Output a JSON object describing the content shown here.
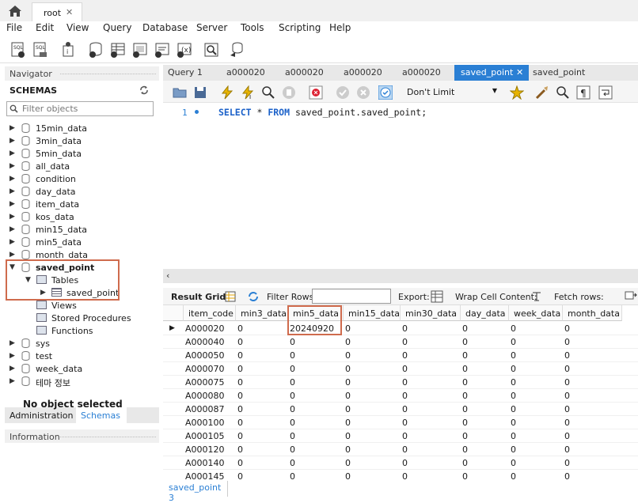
{
  "app": {
    "connection_tab": "root",
    "close_glyph": "✕"
  },
  "menu": [
    "File",
    "Edit",
    "View",
    "Query",
    "Database",
    "Server",
    "Tools",
    "Scripting",
    "Help"
  ],
  "navigator": {
    "header": "Navigator",
    "schemas_title": "SCHEMAS",
    "filter_placeholder": "Filter objects",
    "schemas": [
      "15min_data",
      "3min_data",
      "5min_data",
      "all_data",
      "condition",
      "day_data",
      "item_data",
      "kos_data",
      "min15_data",
      "min5_data",
      "month_data"
    ],
    "expanded_schema": {
      "name": "saved_point",
      "tables_label": "Tables",
      "table": "saved_point",
      "views": "Views",
      "procedures": "Stored Procedures",
      "functions": "Functions"
    },
    "schemas_after": [
      "sys",
      "test",
      "week_data",
      "테마 정보"
    ],
    "tab_administration": "Administration",
    "tab_schemas": "Schemas",
    "info_header": "Information",
    "no_object": "No object selected"
  },
  "query_tabs": [
    "Query 1",
    "a000020",
    "a000020",
    "a000020",
    "a000020",
    "saved_point",
    "saved_point"
  ],
  "editor": {
    "limit": "Don't Limit",
    "line_number": "1",
    "sql_kw1": "SELECT",
    "sql_mid": " * ",
    "sql_kw2": "FROM",
    "sql_rest": " saved_point.saved_point;"
  },
  "results": {
    "result_grid": "Result Grid",
    "filter_rows": "Filter Rows:",
    "export": "Export:",
    "wrap_cell": "Wrap Cell Content:",
    "fetch_rows": "Fetch rows:",
    "columns": [
      "item_code",
      "min3_data",
      "min5_data",
      "min15_data",
      "min30_data",
      "day_data",
      "week_data",
      "month_data"
    ],
    "rows": [
      [
        "A000020",
        "0",
        "20240920",
        "0",
        "0",
        "0",
        "0",
        "0"
      ],
      [
        "A000040",
        "0",
        "0",
        "0",
        "0",
        "0",
        "0",
        "0"
      ],
      [
        "A000050",
        "0",
        "0",
        "0",
        "0",
        "0",
        "0",
        "0"
      ],
      [
        "A000070",
        "0",
        "0",
        "0",
        "0",
        "0",
        "0",
        "0"
      ],
      [
        "A000075",
        "0",
        "0",
        "0",
        "0",
        "0",
        "0",
        "0"
      ],
      [
        "A000080",
        "0",
        "0",
        "0",
        "0",
        "0",
        "0",
        "0"
      ],
      [
        "A000087",
        "0",
        "0",
        "0",
        "0",
        "0",
        "0",
        "0"
      ],
      [
        "A000100",
        "0",
        "0",
        "0",
        "0",
        "0",
        "0",
        "0"
      ],
      [
        "A000105",
        "0",
        "0",
        "0",
        "0",
        "0",
        "0",
        "0"
      ],
      [
        "A000120",
        "0",
        "0",
        "0",
        "0",
        "0",
        "0",
        "0"
      ],
      [
        "A000140",
        "0",
        "0",
        "0",
        "0",
        "0",
        "0",
        "0"
      ],
      [
        "A000145",
        "0",
        "0",
        "0",
        "0",
        "0",
        "0",
        "0"
      ]
    ],
    "result_tab": "saved_point 3"
  },
  "colors": {
    "accent": "#2a7fd4",
    "highlight": "#cf6b4d"
  }
}
